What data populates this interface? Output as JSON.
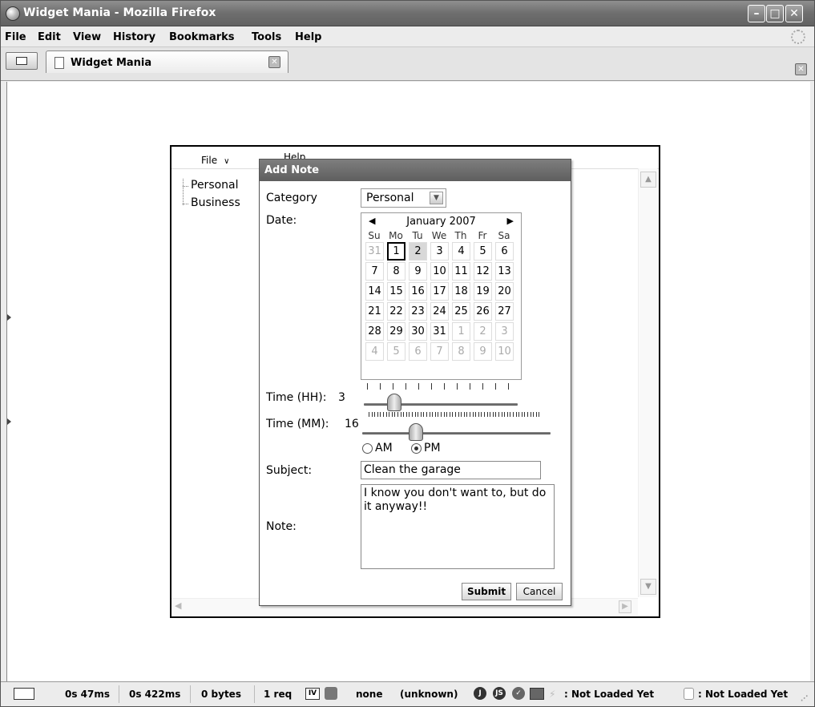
{
  "window": {
    "title": "Widget Mania - Mozilla Firefox"
  },
  "menubar": {
    "items": [
      "File",
      "Edit",
      "View",
      "History",
      "Bookmarks",
      "Tools",
      "Help"
    ]
  },
  "tabs": [
    {
      "label": "Widget Mania"
    }
  ],
  "app": {
    "file_menu": "File",
    "help_menu": "Help",
    "tree": [
      "Personal",
      "Business"
    ]
  },
  "dialog": {
    "title": "Add Note",
    "category_label": "Category",
    "category_value": "Personal",
    "date_label": "Date:",
    "calendar": {
      "month": "January 2007",
      "day_names": [
        "Su",
        "Mo",
        "Tu",
        "We",
        "Th",
        "Fr",
        "Sa"
      ],
      "weeks": [
        [
          "31",
          "1",
          "2",
          "3",
          "4",
          "5",
          "6"
        ],
        [
          "7",
          "8",
          "9",
          "10",
          "11",
          "12",
          "13"
        ],
        [
          "14",
          "15",
          "16",
          "17",
          "18",
          "19",
          "20"
        ],
        [
          "21",
          "22",
          "23",
          "24",
          "25",
          "26",
          "27"
        ],
        [
          "28",
          "29",
          "30",
          "31",
          "1",
          "2",
          "3"
        ],
        [
          "4",
          "5",
          "6",
          "7",
          "8",
          "9",
          "10"
        ]
      ],
      "today": "1",
      "selected": "2"
    },
    "time_hh_label": "Time (HH):",
    "time_hh_value": "3",
    "time_mm_label": "Time (MM):",
    "time_mm_value": "16",
    "am_label": "AM",
    "pm_label": "PM",
    "period_selected": "PM",
    "subject_label": "Subject:",
    "subject_value": "Clean the garage",
    "note_label": "Note:",
    "note_value": "I know you don't want to, but do it anyway!!",
    "submit_label": "Submit",
    "cancel_label": "Cancel"
  },
  "statusbar": {
    "t1": "0s 47ms",
    "t2": "0s 422ms",
    "bytes": "0 bytes",
    "req": "1 req",
    "none": "none",
    "unknown": "(unknown)",
    "not_loaded_1": ": Not Loaded Yet",
    "not_loaded_2": ": Not Loaded Yet"
  }
}
